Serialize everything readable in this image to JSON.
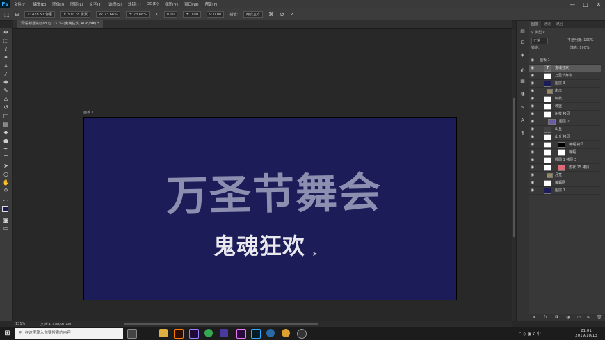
{
  "app": {
    "logo": "Ps"
  },
  "menubar": {
    "items": [
      "文件(F)",
      "编辑(E)",
      "图像(I)",
      "图层(L)",
      "文字(Y)",
      "选择(S)",
      "滤镜(T)",
      "3D(D)",
      "视图(V)",
      "窗口(W)",
      "帮助(H)"
    ]
  },
  "window_controls": {
    "minimize": "—",
    "maximize": "□",
    "close": "✕"
  },
  "options": {
    "x": "X: 428.57 像素",
    "y": "Y: 301.78 像素",
    "w": "W: 73.66%",
    "h": "H: 73.66%",
    "angle": "0.00",
    "hskew": "H: 0.00",
    "vskew": "V: 0.00",
    "interp_label": "插值:",
    "interp_value": "两次立方"
  },
  "document": {
    "tab": "词语-模版的.psd @ 131% (鬼魂狂欢, RGB/8#) *",
    "artboard_label": "画板 1"
  },
  "canvas": {
    "title": "万圣节舞会",
    "subtitle": "鬼魂狂欢",
    "bg_color": "#1c1d58"
  },
  "layers_panel": {
    "tabs": [
      "图层",
      "通道",
      "路径"
    ],
    "blend_mode": "正常",
    "opacity_label": "不透明度: 100%",
    "lock_label": "锁定:",
    "fill_label": "填充: 100%",
    "group_name": "画板 1",
    "layers": [
      "鬼魂狂欢",
      "万圣节舞会",
      "图层 3",
      "南瓜",
      "树枝",
      "城堡",
      "树枝 拷贝",
      "图层 2",
      "山丘",
      "山丘 拷贝",
      "蝙蝠 拷贝",
      "蝙蝠",
      "椭圆 1 拷贝 3",
      "形状 25 拷贝",
      "月亮",
      "蝙蝠网",
      "图层 1"
    ]
  },
  "statusbar": {
    "zoom": "131%",
    "doc": "文档:4.22M/91.4M"
  },
  "taskbar": {
    "search_placeholder": "在这里输入你要搜索的内容",
    "time": "21:01",
    "date": "2019/10/13"
  }
}
